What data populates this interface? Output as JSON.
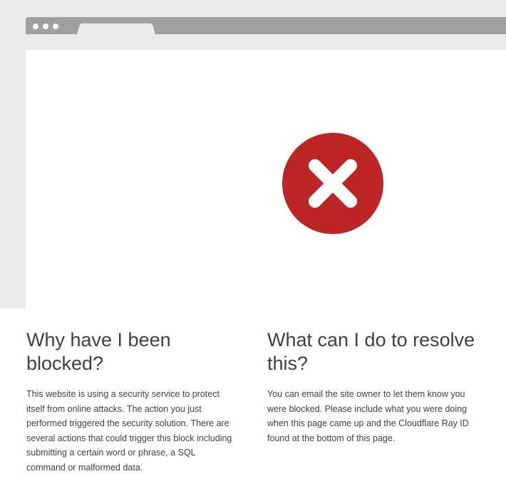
{
  "illustration": {
    "error_icon": "x-circle-icon",
    "error_color": "#bd2426",
    "band_color": "#ebebeb",
    "bar_color": "#a0a0a0"
  },
  "why_blocked": {
    "heading": "Why have I been blocked?",
    "body": "This website is using a security service to protect itself from online attacks. The action you just performed triggered the security solution. There are several actions that could trigger this block including submitting a certain word or phrase, a SQL command or malformed data."
  },
  "resolve": {
    "heading": "What can I do to resolve this?",
    "body": "You can email the site owner to let them know you were blocked. Please include what you were doing when this page came up and the Cloudflare Ray ID found at the bottom of this page."
  }
}
